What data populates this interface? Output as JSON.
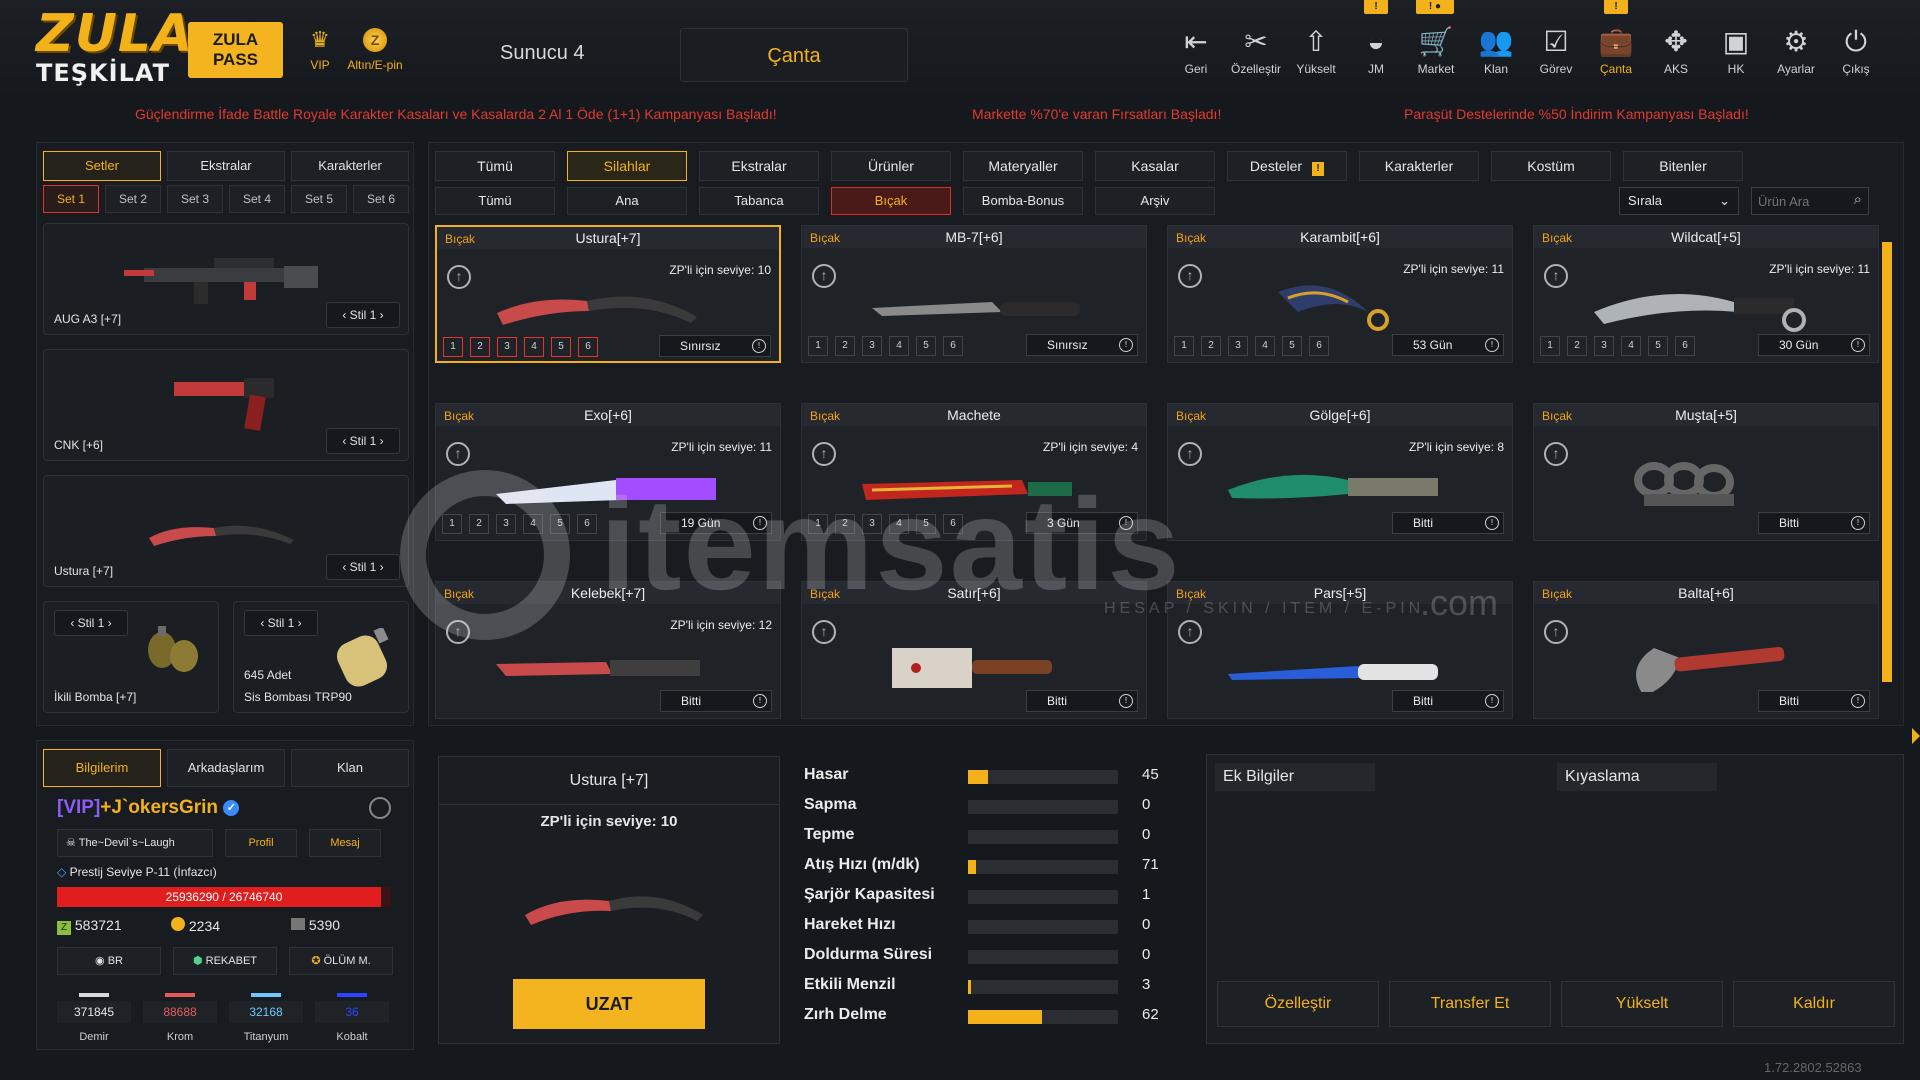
{
  "header": {
    "logo_line1": "ZULA",
    "logo_line2": "TEŞKİLAT",
    "zula_pass_line1": "ZULA",
    "zula_pass_line2": "PASS",
    "vip_label": "VIP",
    "altin_label": "Altın/E-pin",
    "server": "Sunucu 4",
    "page_title": "Çanta",
    "nav": [
      {
        "label": "Geri",
        "icon": "back-icon"
      },
      {
        "label": "Özelleştir",
        "icon": "customize-icon"
      },
      {
        "label": "Yükselt",
        "icon": "upgrade-icon"
      },
      {
        "label": "JM",
        "icon": "jm-icon",
        "badge": "!"
      },
      {
        "label": "Market",
        "icon": "cart-icon",
        "badge": "! ●"
      },
      {
        "label": "Klan",
        "icon": "clan-icon"
      },
      {
        "label": "Görev",
        "icon": "task-icon"
      },
      {
        "label": "Çanta",
        "icon": "bag-icon",
        "badge": "!"
      },
      {
        "label": "AKS",
        "icon": "aks-icon"
      },
      {
        "label": "HK",
        "icon": "hk-icon"
      },
      {
        "label": "Ayarlar",
        "icon": "gear-icon"
      },
      {
        "label": "Çıkış",
        "icon": "power-icon"
      }
    ]
  },
  "ticker": [
    "Güçlendirme İfade Battle Royale Karakter Kasaları ve Kasalarda 2 Al 1 Öde (1+1) Kampanyası Başladı!",
    "Markette %70'e varan Fırsatları Başladı!",
    "Paraşüt Destelerinde %50 İndirim Kampanyası Başladı!"
  ],
  "left_panel": {
    "tabs": [
      "Setler",
      "Ekstralar",
      "Karakterler"
    ],
    "sets": [
      "Set 1",
      "Set 2",
      "Set 3",
      "Set 4",
      "Set 5",
      "Set 6"
    ],
    "slots": [
      {
        "name": "AUG A3 [+7]",
        "style": "Stil 1"
      },
      {
        "name": "CNK [+6]",
        "style": "Stil 1"
      },
      {
        "name": "Ustura [+7]",
        "style": "Stil 1"
      }
    ],
    "small_slots": [
      {
        "name": "İkili Bomba [+7]",
        "style": "Stil 1",
        "count": ""
      },
      {
        "name": "Sis Bombası TRP90",
        "style": "Stil 1",
        "count": "645 Adet"
      }
    ]
  },
  "profile": {
    "tabs": [
      "Bilgilerim",
      "Arkadaşlarım",
      "Klan"
    ],
    "vip_tag": "[VIP]",
    "username": "+J`okersGrin",
    "clan_name": "The~Devil`s~Laugh",
    "profile_button": "Profil",
    "message_button": "Mesaj",
    "prestige": "Prestij Seviye P-11 (İnfazcı)",
    "xp_text": "25936290 / 26746740",
    "xp_progress": 0.97,
    "currency_zp": "583721",
    "currency_gold": "2234",
    "currency_3": "5390",
    "modes": [
      "BR",
      "REKABET",
      "ÖLÜM M."
    ],
    "materials": [
      {
        "label": "Demir",
        "value": "371845",
        "color": "#d8d8d8"
      },
      {
        "label": "Krom",
        "value": "88688",
        "color": "#e85a5a"
      },
      {
        "label": "Titanyum",
        "value": "32168",
        "color": "#6fc7ff"
      },
      {
        "label": "Kobalt",
        "value": "36",
        "color": "#2a46ff"
      }
    ]
  },
  "main": {
    "categories": [
      "Tümü",
      "Silahlar",
      "Ekstralar",
      "Ürünler",
      "Materyaller",
      "Kasalar",
      "Desteler",
      "Karakterler",
      "Kostüm",
      "Bitenler"
    ],
    "active_category": "Silahlar",
    "subcategories": [
      "Tümü",
      "Ana",
      "Tabanca",
      "Bıçak",
      "Bomba-Bonus",
      "Arşiv"
    ],
    "active_subcategory": "Bıçak",
    "sort_label": "Sırala",
    "search_placeholder": "Ürün Ara",
    "items": [
      {
        "type": "Bıçak",
        "name": "Ustura[+7]",
        "level": "ZP'li için seviye: 10",
        "slots": [
          "1",
          "2",
          "3",
          "4",
          "5",
          "6"
        ],
        "duration": "Sınırsız",
        "selected": true
      },
      {
        "type": "Bıçak",
        "name": "MB-7[+6]",
        "level": "",
        "slots": [
          "1",
          "2",
          "3",
          "4",
          "5",
          "6"
        ],
        "duration": "Sınırsız"
      },
      {
        "type": "Bıçak",
        "name": "Karambit[+6]",
        "level": "ZP'li için seviye: 11",
        "slots": [
          "1",
          "2",
          "3",
          "4",
          "5",
          "6"
        ],
        "duration": "53 Gün"
      },
      {
        "type": "Bıçak",
        "name": "Wildcat[+5]",
        "level": "ZP'li için seviye: 11",
        "slots": [
          "1",
          "2",
          "3",
          "4",
          "5",
          "6"
        ],
        "duration": "30 Gün"
      },
      {
        "type": "Bıçak",
        "name": "Exo[+6]",
        "level": "ZP'li için seviye: 11",
        "slots": [
          "1",
          "2",
          "3",
          "4",
          "5",
          "6"
        ],
        "duration": "19 Gün"
      },
      {
        "type": "Bıçak",
        "name": "Machete",
        "level": "ZP'li için seviye: 4",
        "slots": [
          "1",
          "2",
          "3",
          "4",
          "5",
          "6"
        ],
        "duration": "3 Gün"
      },
      {
        "type": "Bıçak",
        "name": "Gölge[+6]",
        "level": "ZP'li için seviye: 8",
        "slots": [],
        "duration": "Bitti"
      },
      {
        "type": "Bıçak",
        "name": "Muşta[+5]",
        "level": "",
        "slots": [],
        "duration": "Bitti"
      },
      {
        "type": "Bıçak",
        "name": "Kelebek[+7]",
        "level": "ZP'li için seviye: 12",
        "slots": [],
        "duration": "Bitti"
      },
      {
        "type": "Bıçak",
        "name": "Satır[+6]",
        "level": "",
        "slots": [],
        "duration": "Bitti"
      },
      {
        "type": "Bıçak",
        "name": "Pars[+5]",
        "level": "",
        "slots": [],
        "duration": "Bitti"
      },
      {
        "type": "Bıçak",
        "name": "Balta[+6]",
        "level": "",
        "slots": [],
        "duration": "Bitti"
      }
    ]
  },
  "detail": {
    "name": "Ustura [+7]",
    "level": "ZP'li için seviye: 10",
    "extend_button": "UZAT"
  },
  "stats": [
    {
      "label": "Hasar",
      "value": "45",
      "fill": 0.13
    },
    {
      "label": "Sapma",
      "value": "0",
      "fill": 0
    },
    {
      "label": "Tepme",
      "value": "0",
      "fill": 0
    },
    {
      "label": "Atış Hızı (m/dk)",
      "value": "71",
      "fill": 0.05
    },
    {
      "label": "Şarjör Kapasitesi",
      "value": "1",
      "fill": 0
    },
    {
      "label": "Hareket Hızı",
      "value": "0",
      "fill": 0
    },
    {
      "label": "Doldurma Süresi",
      "value": "0",
      "fill": 0
    },
    {
      "label": "Etkili Menzil",
      "value": "3",
      "fill": 0.02
    },
    {
      "label": "Zırh Delme",
      "value": "62",
      "fill": 0.49
    }
  ],
  "extra": {
    "ek_bilgiler": "Ek Bilgiler",
    "kiyaslama": "Kıyaslama",
    "buttons": [
      "Özelleştir",
      "Transfer Et",
      "Yükselt",
      "Kaldır"
    ]
  },
  "watermark": {
    "text": "itemsatis",
    "sub": "HESAP / SKIN / ITEM / E-PIN",
    "dotcom": ".com"
  },
  "version": "1.72.2802.52863"
}
